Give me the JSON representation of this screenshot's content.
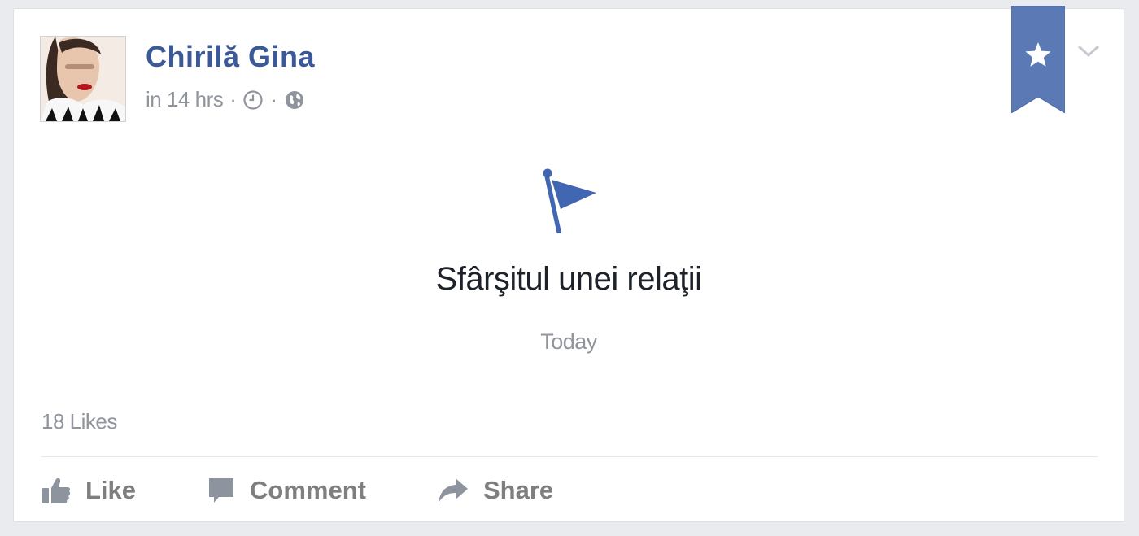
{
  "post": {
    "author": "Chirilă Gina",
    "time": "in 14 hrs",
    "separator": "·",
    "icons": {
      "clock": "clock-icon",
      "audience": "globe-icon",
      "bookmark": "star-bookmark-icon",
      "menu": "chevron-down-icon",
      "event": "flag-icon"
    },
    "event_title": "Sfârşitul unei relaţii",
    "event_date": "Today",
    "likes": "18 Likes"
  },
  "actions": {
    "like": "Like",
    "comment": "Comment",
    "share": "Share"
  },
  "colors": {
    "brand": "#3b5998",
    "bookmark": "#5b79b5",
    "muted": "#90949c",
    "action": "#7f7f7f"
  }
}
